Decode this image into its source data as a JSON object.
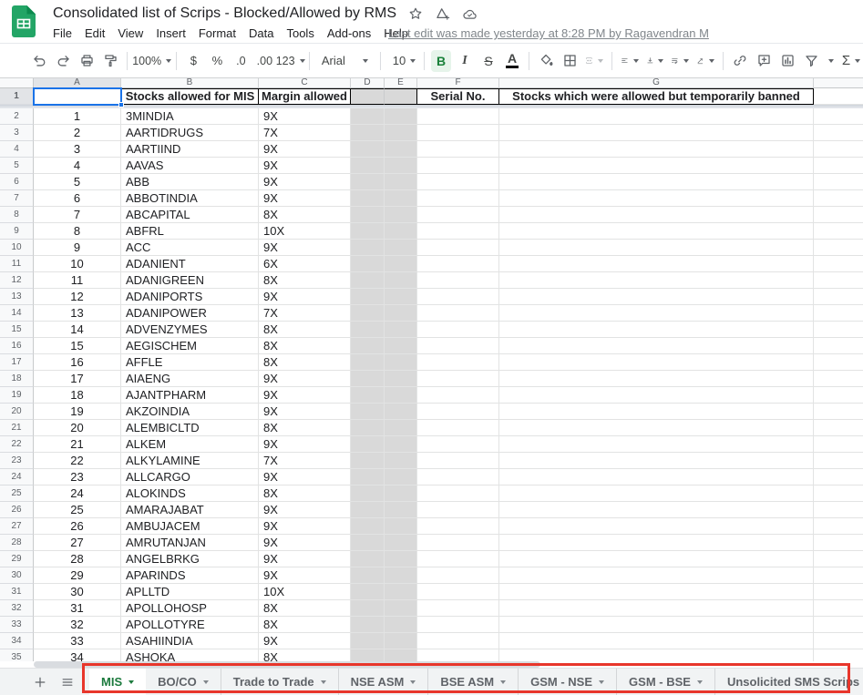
{
  "titlebar": {
    "title": "Consolidated list of Scrips - Blocked/Allowed by RMS",
    "menus": [
      "File",
      "Edit",
      "View",
      "Insert",
      "Format",
      "Data",
      "Tools",
      "Add-ons",
      "Help"
    ],
    "last_edit": "Last edit was made yesterday at 8:28 PM by Ragavendran M",
    "action_icons": [
      "star",
      "add-shortcut-to-drive",
      "saved-to-drive-cloud"
    ]
  },
  "toolbar": {
    "zoom": "100%",
    "currency": "$",
    "percent": "%",
    "decrease_decimal": ".0",
    "increase_decimal": ".00",
    "more_formats": "123",
    "font": "Arial",
    "font_size": "10",
    "bold": "B",
    "italic": "I",
    "strikethrough": "S",
    "text_color": "A",
    "functions": "Σ"
  },
  "grid": {
    "column_letters": [
      "A",
      "B",
      "C",
      "D",
      "E",
      "F",
      "G",
      ""
    ],
    "header_row": {
      "row": "1",
      "b": "Stocks allowed for MIS",
      "c": "Margin allowed",
      "f": "Serial No.",
      "g": "Stocks which were allowed but temporarily banned"
    },
    "rows": [
      {
        "row": "2",
        "serial": "1",
        "stock": "3MINDIA",
        "margin": "9X"
      },
      {
        "row": "3",
        "serial": "2",
        "stock": "AARTIDRUGS",
        "margin": "7X"
      },
      {
        "row": "4",
        "serial": "3",
        "stock": "AARTIIND",
        "margin": "9X"
      },
      {
        "row": "5",
        "serial": "4",
        "stock": "AAVAS",
        "margin": "9X"
      },
      {
        "row": "6",
        "serial": "5",
        "stock": "ABB",
        "margin": "9X"
      },
      {
        "row": "7",
        "serial": "6",
        "stock": "ABBOTINDIA",
        "margin": "9X"
      },
      {
        "row": "8",
        "serial": "7",
        "stock": "ABCAPITAL",
        "margin": "8X"
      },
      {
        "row": "9",
        "serial": "8",
        "stock": "ABFRL",
        "margin": "10X"
      },
      {
        "row": "10",
        "serial": "9",
        "stock": "ACC",
        "margin": "9X"
      },
      {
        "row": "11",
        "serial": "10",
        "stock": "ADANIENT",
        "margin": "6X"
      },
      {
        "row": "12",
        "serial": "11",
        "stock": "ADANIGREEN",
        "margin": "8X"
      },
      {
        "row": "13",
        "serial": "12",
        "stock": "ADANIPORTS",
        "margin": "9X"
      },
      {
        "row": "14",
        "serial": "13",
        "stock": "ADANIPOWER",
        "margin": "7X"
      },
      {
        "row": "15",
        "serial": "14",
        "stock": "ADVENZYMES",
        "margin": "8X"
      },
      {
        "row": "16",
        "serial": "15",
        "stock": "AEGISCHEM",
        "margin": "8X"
      },
      {
        "row": "17",
        "serial": "16",
        "stock": "AFFLE",
        "margin": "8X"
      },
      {
        "row": "18",
        "serial": "17",
        "stock": "AIAENG",
        "margin": "9X"
      },
      {
        "row": "19",
        "serial": "18",
        "stock": "AJANTPHARM",
        "margin": "9X"
      },
      {
        "row": "20",
        "serial": "19",
        "stock": "AKZOINDIA",
        "margin": "9X"
      },
      {
        "row": "21",
        "serial": "20",
        "stock": "ALEMBICLTD",
        "margin": "8X"
      },
      {
        "row": "22",
        "serial": "21",
        "stock": "ALKEM",
        "margin": "9X"
      },
      {
        "row": "23",
        "serial": "22",
        "stock": "ALKYLAMINE",
        "margin": "7X"
      },
      {
        "row": "24",
        "serial": "23",
        "stock": "ALLCARGO",
        "margin": "9X"
      },
      {
        "row": "25",
        "serial": "24",
        "stock": "ALOKINDS",
        "margin": "8X"
      },
      {
        "row": "26",
        "serial": "25",
        "stock": "AMARAJABAT",
        "margin": "9X"
      },
      {
        "row": "27",
        "serial": "26",
        "stock": "AMBUJACEM",
        "margin": "9X"
      },
      {
        "row": "28",
        "serial": "27",
        "stock": "AMRUTANJAN",
        "margin": "9X"
      },
      {
        "row": "29",
        "serial": "28",
        "stock": "ANGELBRKG",
        "margin": "9X"
      },
      {
        "row": "30",
        "serial": "29",
        "stock": "APARINDS",
        "margin": "9X"
      },
      {
        "row": "31",
        "serial": "30",
        "stock": "APLLTD",
        "margin": "10X"
      },
      {
        "row": "32",
        "serial": "31",
        "stock": "APOLLOHOSP",
        "margin": "8X"
      },
      {
        "row": "33",
        "serial": "32",
        "stock": "APOLLOTYRE",
        "margin": "8X"
      },
      {
        "row": "34",
        "serial": "33",
        "stock": "ASAHIINDIA",
        "margin": "9X"
      },
      {
        "row": "35",
        "serial": "34",
        "stock": "ASHOKA",
        "margin": "8X"
      }
    ]
  },
  "sheetbar": {
    "tabs": [
      {
        "label": "MIS",
        "active": true
      },
      {
        "label": "BO/CO"
      },
      {
        "label": "Trade to Trade"
      },
      {
        "label": "NSE ASM"
      },
      {
        "label": "BSE ASM"
      },
      {
        "label": "GSM - NSE"
      },
      {
        "label": "GSM - BSE"
      },
      {
        "label": "Unsolicited SMS Scrips blocked"
      }
    ]
  },
  "colors": {
    "logo_green": "#0f9d58",
    "bold_active_green": "#188038",
    "bold_active_bg": "#e6f4ea",
    "active_tab_green": "#1c7a3d",
    "selection_blue": "#1a73e8",
    "banned_column_gray": "#d9d9d9",
    "annotation_red": "#e8362b"
  }
}
